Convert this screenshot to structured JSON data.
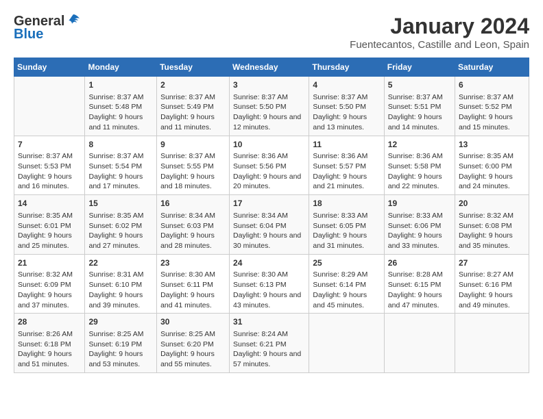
{
  "header": {
    "logo_general": "General",
    "logo_blue": "Blue",
    "month_year": "January 2024",
    "location": "Fuentecantos, Castille and Leon, Spain"
  },
  "weekdays": [
    "Sunday",
    "Monday",
    "Tuesday",
    "Wednesday",
    "Thursday",
    "Friday",
    "Saturday"
  ],
  "weeks": [
    [
      {
        "day": "",
        "sunrise": "",
        "sunset": "",
        "daylight": ""
      },
      {
        "day": "1",
        "sunrise": "Sunrise: 8:37 AM",
        "sunset": "Sunset: 5:48 PM",
        "daylight": "Daylight: 9 hours and 11 minutes."
      },
      {
        "day": "2",
        "sunrise": "Sunrise: 8:37 AM",
        "sunset": "Sunset: 5:49 PM",
        "daylight": "Daylight: 9 hours and 11 minutes."
      },
      {
        "day": "3",
        "sunrise": "Sunrise: 8:37 AM",
        "sunset": "Sunset: 5:50 PM",
        "daylight": "Daylight: 9 hours and 12 minutes."
      },
      {
        "day": "4",
        "sunrise": "Sunrise: 8:37 AM",
        "sunset": "Sunset: 5:50 PM",
        "daylight": "Daylight: 9 hours and 13 minutes."
      },
      {
        "day": "5",
        "sunrise": "Sunrise: 8:37 AM",
        "sunset": "Sunset: 5:51 PM",
        "daylight": "Daylight: 9 hours and 14 minutes."
      },
      {
        "day": "6",
        "sunrise": "Sunrise: 8:37 AM",
        "sunset": "Sunset: 5:52 PM",
        "daylight": "Daylight: 9 hours and 15 minutes."
      }
    ],
    [
      {
        "day": "7",
        "sunrise": "Sunrise: 8:37 AM",
        "sunset": "Sunset: 5:53 PM",
        "daylight": "Daylight: 9 hours and 16 minutes."
      },
      {
        "day": "8",
        "sunrise": "Sunrise: 8:37 AM",
        "sunset": "Sunset: 5:54 PM",
        "daylight": "Daylight: 9 hours and 17 minutes."
      },
      {
        "day": "9",
        "sunrise": "Sunrise: 8:37 AM",
        "sunset": "Sunset: 5:55 PM",
        "daylight": "Daylight: 9 hours and 18 minutes."
      },
      {
        "day": "10",
        "sunrise": "Sunrise: 8:36 AM",
        "sunset": "Sunset: 5:56 PM",
        "daylight": "Daylight: 9 hours and 20 minutes."
      },
      {
        "day": "11",
        "sunrise": "Sunrise: 8:36 AM",
        "sunset": "Sunset: 5:57 PM",
        "daylight": "Daylight: 9 hours and 21 minutes."
      },
      {
        "day": "12",
        "sunrise": "Sunrise: 8:36 AM",
        "sunset": "Sunset: 5:58 PM",
        "daylight": "Daylight: 9 hours and 22 minutes."
      },
      {
        "day": "13",
        "sunrise": "Sunrise: 8:35 AM",
        "sunset": "Sunset: 6:00 PM",
        "daylight": "Daylight: 9 hours and 24 minutes."
      }
    ],
    [
      {
        "day": "14",
        "sunrise": "Sunrise: 8:35 AM",
        "sunset": "Sunset: 6:01 PM",
        "daylight": "Daylight: 9 hours and 25 minutes."
      },
      {
        "day": "15",
        "sunrise": "Sunrise: 8:35 AM",
        "sunset": "Sunset: 6:02 PM",
        "daylight": "Daylight: 9 hours and 27 minutes."
      },
      {
        "day": "16",
        "sunrise": "Sunrise: 8:34 AM",
        "sunset": "Sunset: 6:03 PM",
        "daylight": "Daylight: 9 hours and 28 minutes."
      },
      {
        "day": "17",
        "sunrise": "Sunrise: 8:34 AM",
        "sunset": "Sunset: 6:04 PM",
        "daylight": "Daylight: 9 hours and 30 minutes."
      },
      {
        "day": "18",
        "sunrise": "Sunrise: 8:33 AM",
        "sunset": "Sunset: 6:05 PM",
        "daylight": "Daylight: 9 hours and 31 minutes."
      },
      {
        "day": "19",
        "sunrise": "Sunrise: 8:33 AM",
        "sunset": "Sunset: 6:06 PM",
        "daylight": "Daylight: 9 hours and 33 minutes."
      },
      {
        "day": "20",
        "sunrise": "Sunrise: 8:32 AM",
        "sunset": "Sunset: 6:08 PM",
        "daylight": "Daylight: 9 hours and 35 minutes."
      }
    ],
    [
      {
        "day": "21",
        "sunrise": "Sunrise: 8:32 AM",
        "sunset": "Sunset: 6:09 PM",
        "daylight": "Daylight: 9 hours and 37 minutes."
      },
      {
        "day": "22",
        "sunrise": "Sunrise: 8:31 AM",
        "sunset": "Sunset: 6:10 PM",
        "daylight": "Daylight: 9 hours and 39 minutes."
      },
      {
        "day": "23",
        "sunrise": "Sunrise: 8:30 AM",
        "sunset": "Sunset: 6:11 PM",
        "daylight": "Daylight: 9 hours and 41 minutes."
      },
      {
        "day": "24",
        "sunrise": "Sunrise: 8:30 AM",
        "sunset": "Sunset: 6:13 PM",
        "daylight": "Daylight: 9 hours and 43 minutes."
      },
      {
        "day": "25",
        "sunrise": "Sunrise: 8:29 AM",
        "sunset": "Sunset: 6:14 PM",
        "daylight": "Daylight: 9 hours and 45 minutes."
      },
      {
        "day": "26",
        "sunrise": "Sunrise: 8:28 AM",
        "sunset": "Sunset: 6:15 PM",
        "daylight": "Daylight: 9 hours and 47 minutes."
      },
      {
        "day": "27",
        "sunrise": "Sunrise: 8:27 AM",
        "sunset": "Sunset: 6:16 PM",
        "daylight": "Daylight: 9 hours and 49 minutes."
      }
    ],
    [
      {
        "day": "28",
        "sunrise": "Sunrise: 8:26 AM",
        "sunset": "Sunset: 6:18 PM",
        "daylight": "Daylight: 9 hours and 51 minutes."
      },
      {
        "day": "29",
        "sunrise": "Sunrise: 8:25 AM",
        "sunset": "Sunset: 6:19 PM",
        "daylight": "Daylight: 9 hours and 53 minutes."
      },
      {
        "day": "30",
        "sunrise": "Sunrise: 8:25 AM",
        "sunset": "Sunset: 6:20 PM",
        "daylight": "Daylight: 9 hours and 55 minutes."
      },
      {
        "day": "31",
        "sunrise": "Sunrise: 8:24 AM",
        "sunset": "Sunset: 6:21 PM",
        "daylight": "Daylight: 9 hours and 57 minutes."
      },
      {
        "day": "",
        "sunrise": "",
        "sunset": "",
        "daylight": ""
      },
      {
        "day": "",
        "sunrise": "",
        "sunset": "",
        "daylight": ""
      },
      {
        "day": "",
        "sunrise": "",
        "sunset": "",
        "daylight": ""
      }
    ]
  ]
}
